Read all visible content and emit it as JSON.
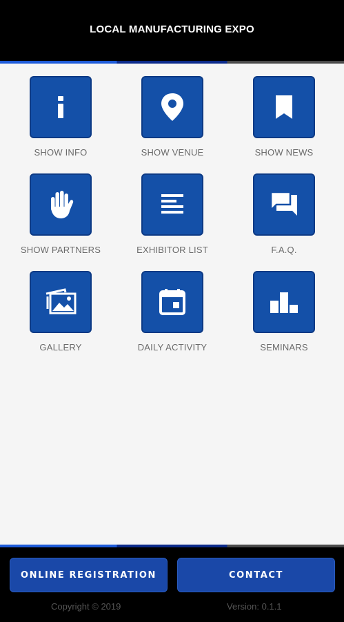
{
  "header": {
    "title": "LOCAL MANUFACTURING EXPO"
  },
  "tiles": [
    {
      "label": "SHOW INFO",
      "icon": "info-icon"
    },
    {
      "label": "SHOW VENUE",
      "icon": "map-pin-icon"
    },
    {
      "label": "SHOW NEWS",
      "icon": "bookmark-icon"
    },
    {
      "label": "SHOW PARTNERS",
      "icon": "hand-icon"
    },
    {
      "label": "EXHIBITOR LIST",
      "icon": "list-icon"
    },
    {
      "label": "F.A.Q.",
      "icon": "chat-icon"
    },
    {
      "label": "GALLERY",
      "icon": "gallery-icon"
    },
    {
      "label": "DAILY ACTIVITY",
      "icon": "calendar-icon"
    },
    {
      "label": "SEMINARS",
      "icon": "bar-chart-icon"
    }
  ],
  "footer": {
    "registration_label": "ONLINE REGISTRATION",
    "contact_label": "CONTACT",
    "copyright": "Copyright © 2019",
    "version": "Version: 0.1.1"
  },
  "colors": {
    "header_bg": "#000000",
    "tile_bg": "#1450a8",
    "button_bg": "#1a48a8",
    "page_bg": "#f5f5f5"
  }
}
